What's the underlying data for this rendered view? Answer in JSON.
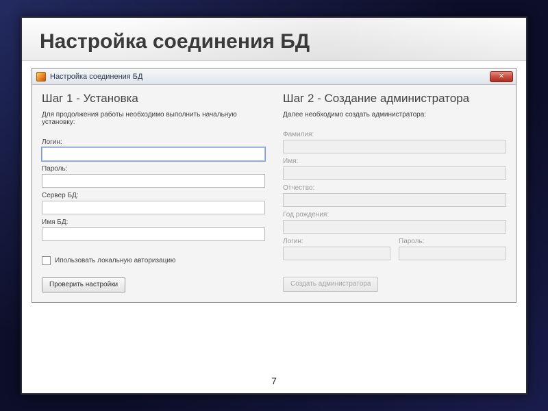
{
  "slide": {
    "title": "Настройка соединения БД",
    "page_number": "7"
  },
  "window": {
    "title": "Настройка соединения БД"
  },
  "step1": {
    "heading": "Шаг 1 - Установка",
    "description": "Для продолжения работы необходимо выполнить начальную установку:",
    "fields": {
      "login_label": "Логин:",
      "login_value": "",
      "password_label": "Пароль:",
      "password_value": "",
      "server_label": "Сервер БД:",
      "server_value": "",
      "dbname_label": "Имя БД:",
      "dbname_value": ""
    },
    "checkbox_label": "Ипользовать локальную авторизацию",
    "button_label": "Проверить настройки"
  },
  "step2": {
    "heading": "Шаг 2 - Создание администратора",
    "description": "Далее необходимо создать администратора:",
    "fields": {
      "lastname_label": "Фамилия:",
      "firstname_label": "Имя:",
      "middlename_label": "Отчество:",
      "birthyear_label": "Год рождения:",
      "login_label": "Логин:",
      "password_label": "Пароль:"
    },
    "button_label": "Создать администратора"
  }
}
